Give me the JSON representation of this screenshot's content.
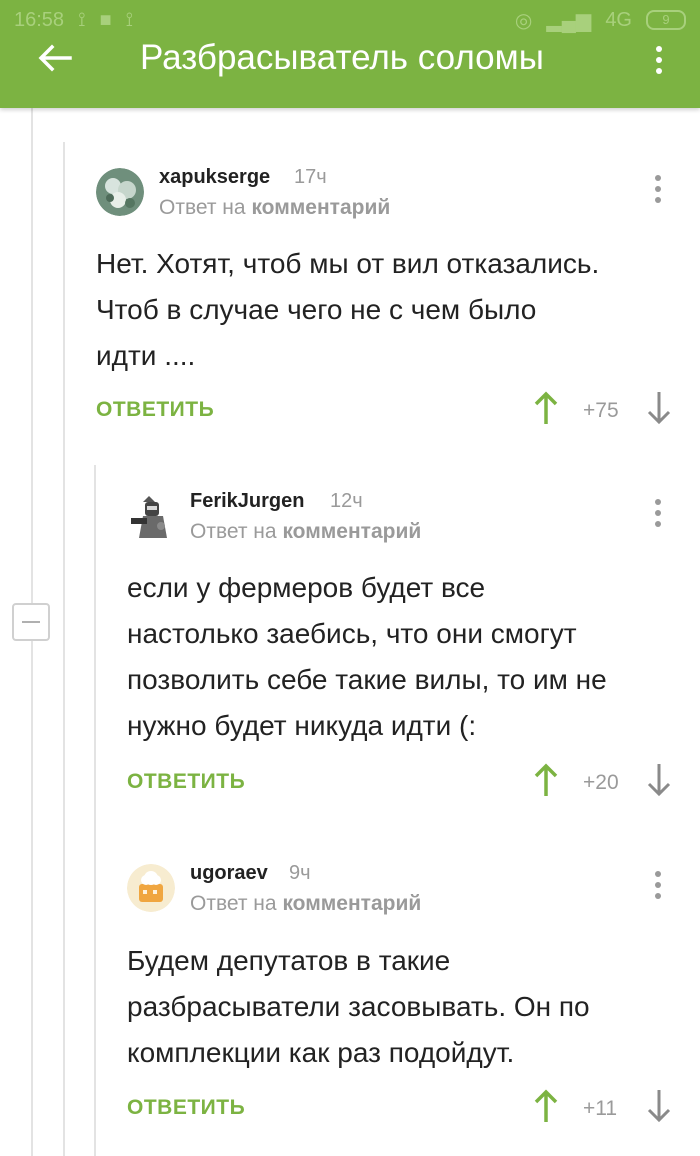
{
  "status_bar": {
    "time": "16:58",
    "network": "4G",
    "battery": "9"
  },
  "header": {
    "title": "Разбрасыватель соломы"
  },
  "comments": [
    {
      "username": "xapukserge",
      "time": "17ч",
      "reply_prefix": "Ответ на",
      "reply_target": "комментарий",
      "lines": [
        "Нет. Хотят, чтоб мы от вил отказались.",
        "Чтоб в случае чего не с чем было",
        "идти ...."
      ],
      "reply_label": "ОТВЕТИТЬ",
      "rating": "+75"
    },
    {
      "username": "FerikJurgen",
      "time": "12ч",
      "reply_prefix": "Ответ на",
      "reply_target": "комментарий",
      "lines": [
        "если у фермеров будет все",
        "настолько заебись, что они смогут",
        "позволить себе такие вилы, то им не",
        "нужно будет никуда идти (:"
      ],
      "reply_label": "ОТВЕТИТЬ",
      "rating": "+20"
    },
    {
      "username": "ugoraev",
      "time": "9ч",
      "reply_prefix": "Ответ на",
      "reply_target": "комментарий",
      "lines": [
        "Будем депутатов в такие",
        "разбрасыватели засовывать. Он по",
        "комплекции как раз подойдут."
      ],
      "reply_label": "ОТВЕТИТЬ",
      "rating": "+11"
    }
  ],
  "icons": {
    "back": "arrow-left-icon",
    "more": "more-vertical-icon",
    "upvote": "arrow-up-icon",
    "downvote": "arrow-down-icon",
    "collapse": "minus-icon"
  },
  "colors": {
    "accent": "#7cb342",
    "muted": "#9a9a9a",
    "text": "#222222"
  }
}
